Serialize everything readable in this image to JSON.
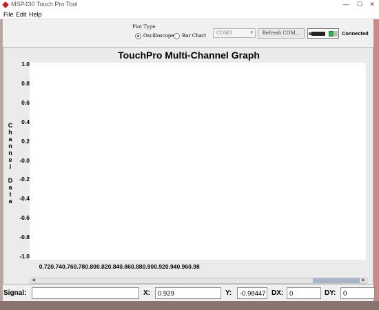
{
  "window": {
    "title": "MSP430 Touch Pro Tool",
    "min_glyph": "—",
    "max_glyph": "☐",
    "close_glyph": "✕"
  },
  "menu": {
    "file": "File",
    "edit": "Edit",
    "help": "Help"
  },
  "controls": {
    "plot_type_label": "Plot Type",
    "oscilloscope_label": "Oscilloscope",
    "bar_chart_label": "Bar Chart",
    "selected_plot_type": "Oscilloscope",
    "com_port": "COM3",
    "refresh_label": "Refresh COM...",
    "connection_status": "Connected"
  },
  "graph": {
    "title": "TouchPro Multi-Channel Graph",
    "ylabel_word1": [
      "C",
      "h",
      "a",
      "n",
      "n",
      "e",
      "l"
    ],
    "ylabel_word2": [
      "D",
      "a",
      "t",
      "a"
    ],
    "y_ticks": [
      "1.0",
      "0.8",
      "0.6",
      "0.4",
      "0.2",
      "-0.0",
      "-0.2",
      "-0.4",
      "-0.6",
      "-0.8",
      "-1.0"
    ],
    "x_ticks": [
      "0.72",
      "0.74",
      "0.76",
      "0.78",
      "0.80",
      "0.82",
      "0.84",
      "0.86",
      "0.88",
      "0.90",
      "0.92",
      "0.94",
      "0.96",
      "0.98"
    ]
  },
  "status": {
    "signal_label": "Signal:",
    "signal_value": "",
    "x_label": "X:",
    "x_value": "0.929",
    "y_label": "Y:",
    "y_value": "-0.98447",
    "dx_label": "DX:",
    "dx_value": "0",
    "dy_label": "DY:",
    "dy_value": "0"
  }
}
